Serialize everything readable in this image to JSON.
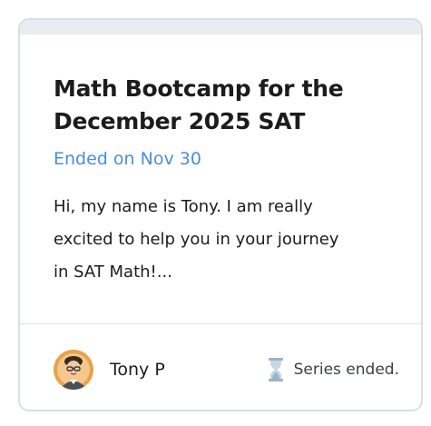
{
  "card": {
    "title_line1": "Math Bootcamp for the",
    "title_line2": "December 2025 SAT",
    "status": "Ended on Nov 30",
    "description_line1": "Hi, my name is Tony. I am really",
    "description_line2": "excited to help you in your journey",
    "description_line3": "in SAT Math!...",
    "instructor_name": "Tony P",
    "series_status": "Series ended."
  },
  "colors": {
    "status_blue": "#4a8fd6",
    "hourglass": "#9ab3cc",
    "avatar_ring": "#e9a24a"
  },
  "icons": {
    "avatar": "instructor-avatar",
    "series": "hourglass-icon"
  }
}
